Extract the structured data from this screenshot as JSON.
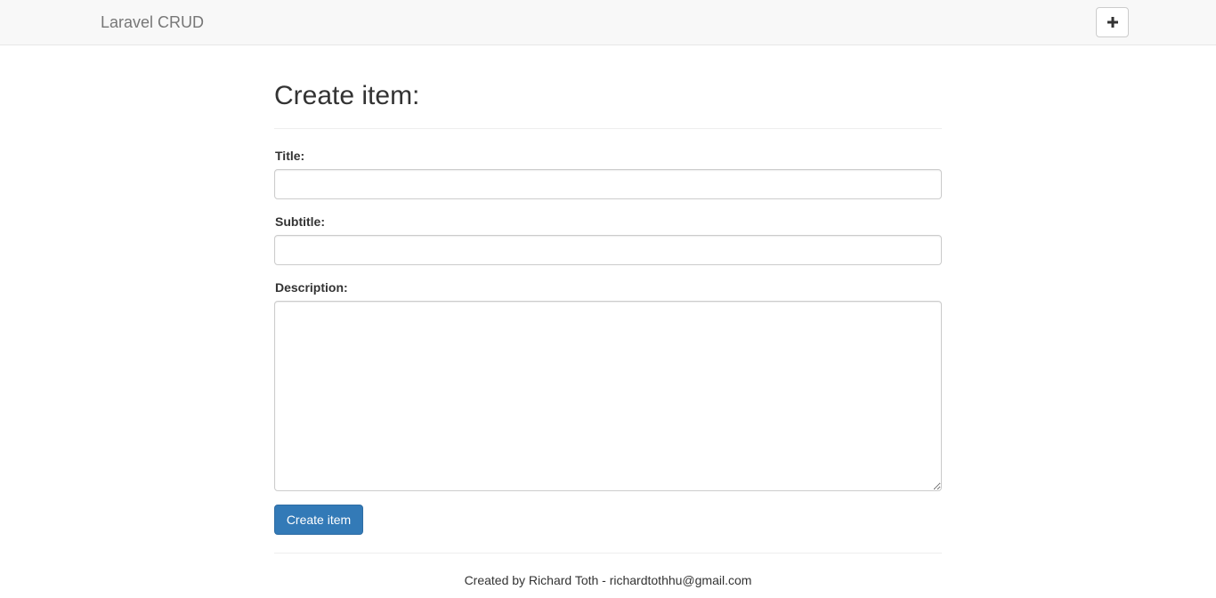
{
  "navbar": {
    "brand": "Laravel CRUD",
    "add_icon": "plus-icon"
  },
  "form": {
    "heading": "Create item:",
    "title_label": "Title:",
    "title_value": "",
    "subtitle_label": "Subtitle:",
    "subtitle_value": "",
    "description_label": "Description:",
    "description_value": "",
    "submit_label": "Create item"
  },
  "footer": {
    "credit": "Created by Richard Toth - richardtothhu@gmail.com"
  },
  "colors": {
    "navbar_bg": "#f8f8f8",
    "primary": "#337ab7",
    "text": "#333333",
    "brand_text": "#777777"
  }
}
